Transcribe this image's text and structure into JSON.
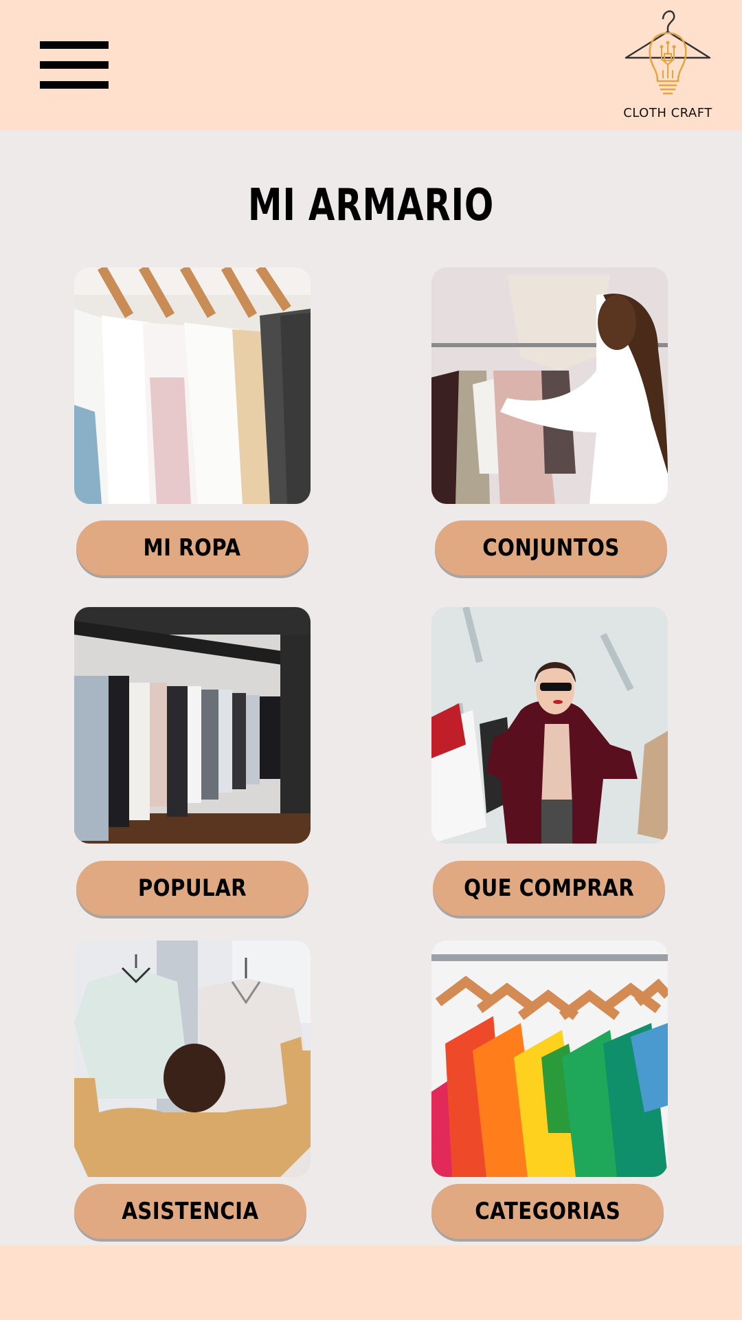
{
  "header": {
    "menu_icon": "hamburger-menu-icon",
    "logo_icon": "hanger-lightbulb-circuit-icon",
    "logo_text": "CLOTH CRAFT"
  },
  "main": {
    "title": "MI ARMARIO",
    "cards": [
      {
        "label": "MI ROPA",
        "image": "white shirts on wooden hangers"
      },
      {
        "label": "CONJUNTOS",
        "image": "woman browsing clothes rack"
      },
      {
        "label": "POPULAR",
        "image": "clothing store racks"
      },
      {
        "label": "QUE COMPRAR",
        "image": "woman with shopping bags"
      },
      {
        "label": "ASISTENCIA",
        "image": "person holding up two sweaters"
      },
      {
        "label": "CATEGORIAS",
        "image": "colorful shirts on hangers"
      }
    ]
  },
  "colors": {
    "header_bg": "#ffe0cd",
    "page_bg": "#efeaea",
    "button_bg": "#e0a982",
    "logo_accent": "#e8a43c"
  }
}
